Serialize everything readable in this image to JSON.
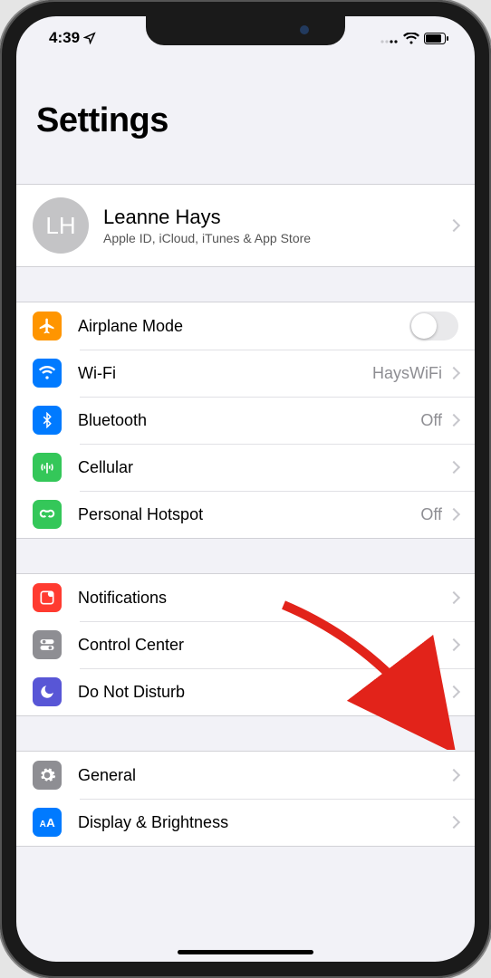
{
  "status": {
    "time": "4:39",
    "location_icon": "➤"
  },
  "header": {
    "title": "Settings"
  },
  "profile": {
    "initials": "LH",
    "name": "Leanne Hays",
    "subtitle": "Apple ID, iCloud, iTunes & App Store"
  },
  "group_connectivity": {
    "airplane": {
      "label": "Airplane Mode"
    },
    "wifi": {
      "label": "Wi-Fi",
      "value": "HaysWiFi"
    },
    "bluetooth": {
      "label": "Bluetooth",
      "value": "Off"
    },
    "cellular": {
      "label": "Cellular"
    },
    "hotspot": {
      "label": "Personal Hotspot",
      "value": "Off"
    }
  },
  "group_notify": {
    "notifications": {
      "label": "Notifications"
    },
    "control_center": {
      "label": "Control Center"
    },
    "dnd": {
      "label": "Do Not Disturb"
    }
  },
  "group_general": {
    "general": {
      "label": "General"
    },
    "display": {
      "label": "Display & Brightness"
    }
  },
  "icon_colors": {
    "airplane": "#ff9500",
    "wifi": "#007aff",
    "bluetooth": "#007aff",
    "cellular": "#34c759",
    "hotspot": "#34c759",
    "notifications": "#ff3b30",
    "control_center": "#8e8e93",
    "dnd": "#5856d6",
    "general": "#8e8e93",
    "display": "#007aff"
  }
}
